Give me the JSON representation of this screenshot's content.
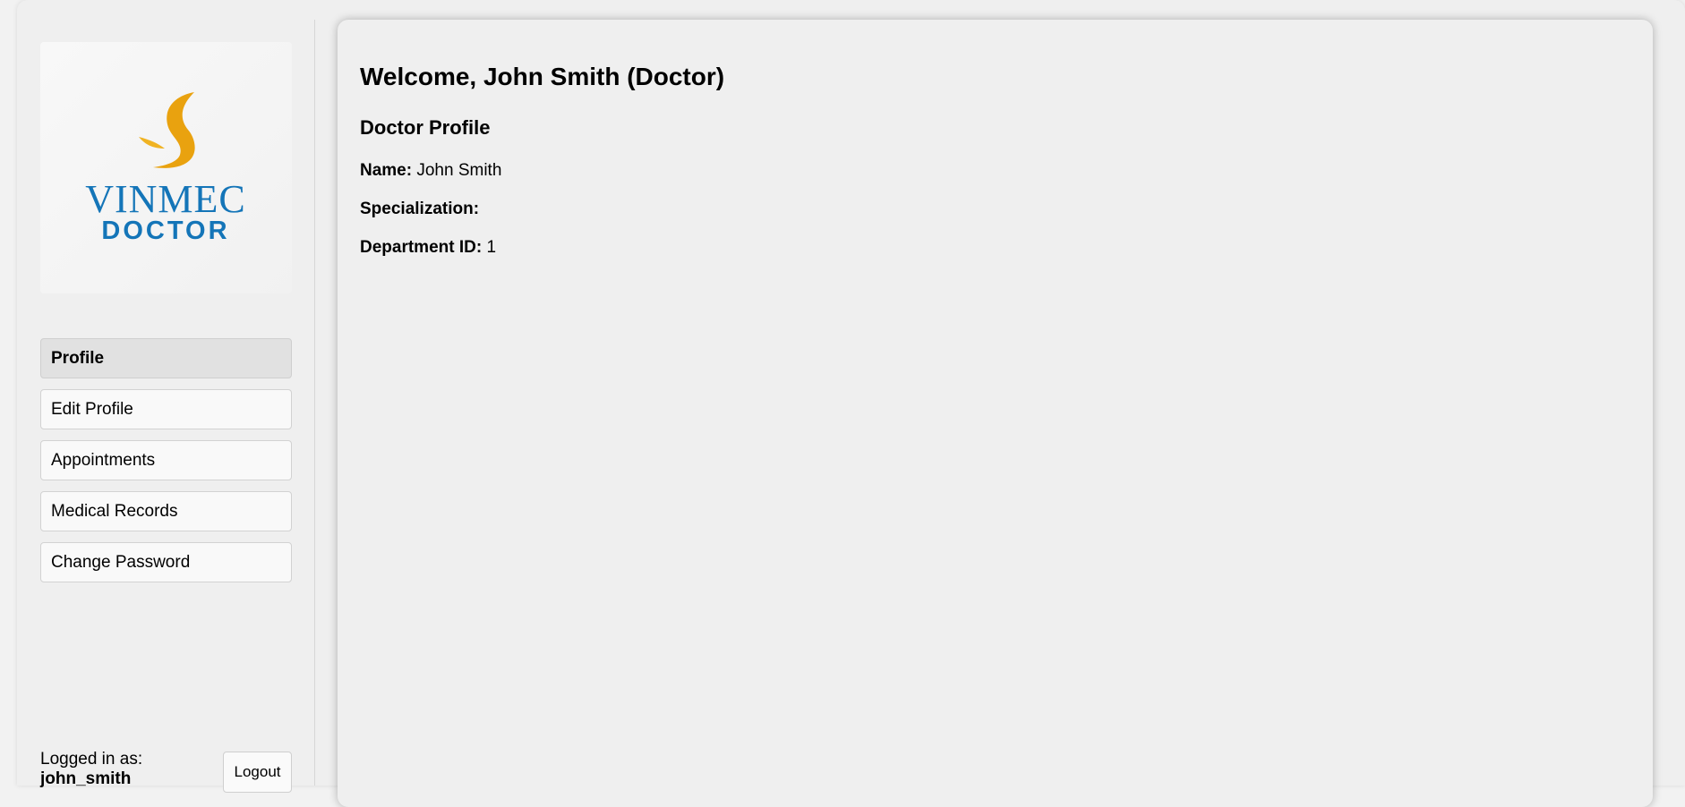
{
  "sidebar": {
    "logo": {
      "brand_text": "VINMEC",
      "sub_text": "DOCTOR",
      "brand_color": "#1475b8",
      "flame_color": "#e9a20f"
    },
    "nav": [
      {
        "label": "Profile",
        "active": true
      },
      {
        "label": "Edit Profile",
        "active": false
      },
      {
        "label": "Appointments",
        "active": false
      },
      {
        "label": "Medical Records",
        "active": false
      },
      {
        "label": "Change Password",
        "active": false
      }
    ],
    "user": {
      "logged_in_label": "Logged in as:",
      "username": "john_smith"
    },
    "logout_label": "Logout"
  },
  "main": {
    "welcome": "Welcome, John Smith (Doctor)",
    "section_title": "Doctor Profile",
    "fields": [
      {
        "label": "Name:",
        "value": "John Smith"
      },
      {
        "label": "Specialization:",
        "value": ""
      },
      {
        "label": "Department ID:",
        "value": "1"
      }
    ]
  }
}
